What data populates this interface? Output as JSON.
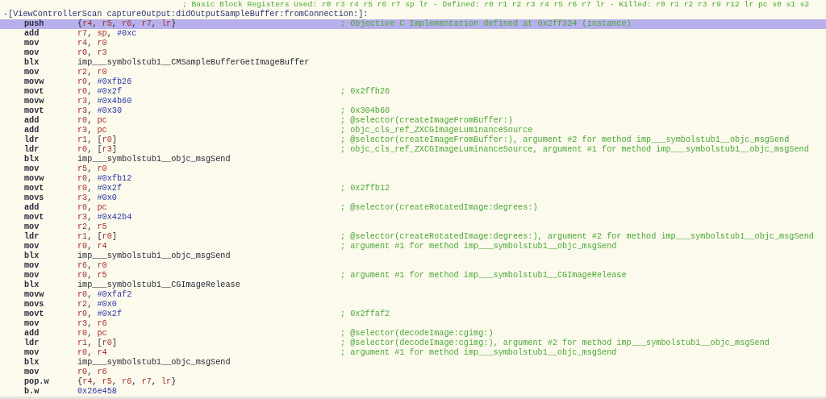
{
  "block_comment": "; Basic Block Registers Used: r0 r3 r4 r5 r6 r7 sp lr - Defined: r0 r1 r2 r3 r4 r5 r6 r7 lr - Killed: r0 r1 r2 r3 r9 r12 lr pc s0 s1 s2",
  "method_header": "-[ViewControllerScan captureOutput:didOutputSampleBuffer:fromConnection:]:",
  "lines": [
    {
      "mnemonic": "push",
      "operands": [
        {
          "text": "{",
          "kind": "punct"
        },
        {
          "text": "r4",
          "kind": "reg"
        },
        {
          "text": ", ",
          "kind": "punct"
        },
        {
          "text": "r5",
          "kind": "reg"
        },
        {
          "text": ", ",
          "kind": "punct"
        },
        {
          "text": "r6",
          "kind": "reg"
        },
        {
          "text": ", ",
          "kind": "punct"
        },
        {
          "text": "r7",
          "kind": "reg"
        },
        {
          "text": ", ",
          "kind": "punct"
        },
        {
          "text": "lr",
          "kind": "reg"
        },
        {
          "text": "}",
          "kind": "punct"
        }
      ],
      "comment": "; Objective C Implementation defined at 0x2ff324 (instance)",
      "selected": true
    },
    {
      "mnemonic": "add",
      "operands": [
        {
          "text": "r7",
          "kind": "reg"
        },
        {
          "text": ", ",
          "kind": "punct"
        },
        {
          "text": "sp",
          "kind": "reg"
        },
        {
          "text": ", ",
          "kind": "punct"
        },
        {
          "text": "#0xc",
          "kind": "imm"
        }
      ],
      "selected": false
    },
    {
      "mnemonic": "mov",
      "operands": [
        {
          "text": "r4",
          "kind": "reg"
        },
        {
          "text": ", ",
          "kind": "punct"
        },
        {
          "text": "r0",
          "kind": "reg"
        }
      ],
      "selected": false
    },
    {
      "mnemonic": "mov",
      "operands": [
        {
          "text": "r0",
          "kind": "reg"
        },
        {
          "text": ", ",
          "kind": "punct"
        },
        {
          "text": "r3",
          "kind": "reg"
        }
      ],
      "selected": false
    },
    {
      "mnemonic": "blx",
      "operands": [
        {
          "text": "imp___symbolstub1__CMSampleBufferGetImageBuffer",
          "kind": "sym"
        }
      ],
      "selected": false
    },
    {
      "mnemonic": "mov",
      "operands": [
        {
          "text": "r2",
          "kind": "reg"
        },
        {
          "text": ", ",
          "kind": "punct"
        },
        {
          "text": "r0",
          "kind": "reg"
        }
      ],
      "selected": false
    },
    {
      "mnemonic": "movw",
      "operands": [
        {
          "text": "r0",
          "kind": "reg"
        },
        {
          "text": ", ",
          "kind": "punct"
        },
        {
          "text": "#0xfb26",
          "kind": "imm"
        }
      ],
      "selected": false
    },
    {
      "mnemonic": "movt",
      "operands": [
        {
          "text": "r0",
          "kind": "reg"
        },
        {
          "text": ", ",
          "kind": "punct"
        },
        {
          "text": "#0x2f",
          "kind": "imm"
        }
      ],
      "comment": "; 0x2ffb26",
      "selected": false
    },
    {
      "mnemonic": "movw",
      "operands": [
        {
          "text": "r3",
          "kind": "reg"
        },
        {
          "text": ", ",
          "kind": "punct"
        },
        {
          "text": "#0x4b60",
          "kind": "imm"
        }
      ],
      "selected": false
    },
    {
      "mnemonic": "movt",
      "operands": [
        {
          "text": "r3",
          "kind": "reg"
        },
        {
          "text": ", ",
          "kind": "punct"
        },
        {
          "text": "#0x30",
          "kind": "imm"
        }
      ],
      "comment": "; 0x304b60",
      "selected": false
    },
    {
      "mnemonic": "add",
      "operands": [
        {
          "text": "r0",
          "kind": "reg"
        },
        {
          "text": ", ",
          "kind": "punct"
        },
        {
          "text": "pc",
          "kind": "reg"
        }
      ],
      "comment": "; @selector(createImageFromBuffer:)",
      "selected": false
    },
    {
      "mnemonic": "add",
      "operands": [
        {
          "text": "r3",
          "kind": "reg"
        },
        {
          "text": ", ",
          "kind": "punct"
        },
        {
          "text": "pc",
          "kind": "reg"
        }
      ],
      "comment": "; objc_cls_ref_ZXCGImageLuminanceSource",
      "selected": false
    },
    {
      "mnemonic": "ldr",
      "operands": [
        {
          "text": "r1",
          "kind": "reg"
        },
        {
          "text": ", [",
          "kind": "punct"
        },
        {
          "text": "r0",
          "kind": "reg"
        },
        {
          "text": "]",
          "kind": "punct"
        }
      ],
      "comment": "; @selector(createImageFromBuffer:), argument #2 for method imp___symbolstub1__objc_msgSend",
      "selected": false
    },
    {
      "mnemonic": "ldr",
      "operands": [
        {
          "text": "r0",
          "kind": "reg"
        },
        {
          "text": ", [",
          "kind": "punct"
        },
        {
          "text": "r3",
          "kind": "reg"
        },
        {
          "text": "]",
          "kind": "punct"
        }
      ],
      "comment": "; objc_cls_ref_ZXCGImageLuminanceSource, argument #1 for method imp___symbolstub1__objc_msgSend",
      "selected": false
    },
    {
      "mnemonic": "blx",
      "operands": [
        {
          "text": "imp___symbolstub1__objc_msgSend",
          "kind": "sym"
        }
      ],
      "selected": false
    },
    {
      "mnemonic": "mov",
      "operands": [
        {
          "text": "r5",
          "kind": "reg"
        },
        {
          "text": ", ",
          "kind": "punct"
        },
        {
          "text": "r0",
          "kind": "reg"
        }
      ],
      "selected": false
    },
    {
      "mnemonic": "movw",
      "operands": [
        {
          "text": "r0",
          "kind": "reg"
        },
        {
          "text": ", ",
          "kind": "punct"
        },
        {
          "text": "#0xfb12",
          "kind": "imm"
        }
      ],
      "selected": false
    },
    {
      "mnemonic": "movt",
      "operands": [
        {
          "text": "r0",
          "kind": "reg"
        },
        {
          "text": ", ",
          "kind": "punct"
        },
        {
          "text": "#0x2f",
          "kind": "imm"
        }
      ],
      "comment": "; 0x2ffb12",
      "selected": false
    },
    {
      "mnemonic": "movs",
      "operands": [
        {
          "text": "r3",
          "kind": "reg"
        },
        {
          "text": ", ",
          "kind": "punct"
        },
        {
          "text": "#0x0",
          "kind": "imm"
        }
      ],
      "selected": false
    },
    {
      "mnemonic": "add",
      "operands": [
        {
          "text": "r0",
          "kind": "reg"
        },
        {
          "text": ", ",
          "kind": "punct"
        },
        {
          "text": "pc",
          "kind": "reg"
        }
      ],
      "comment": "; @selector(createRotatedImage:degrees:)",
      "selected": false
    },
    {
      "mnemonic": "movt",
      "operands": [
        {
          "text": "r3",
          "kind": "reg"
        },
        {
          "text": ", ",
          "kind": "punct"
        },
        {
          "text": "#0x42b4",
          "kind": "imm"
        }
      ],
      "selected": false
    },
    {
      "mnemonic": "mov",
      "operands": [
        {
          "text": "r2",
          "kind": "reg"
        },
        {
          "text": ", ",
          "kind": "punct"
        },
        {
          "text": "r5",
          "kind": "reg"
        }
      ],
      "selected": false
    },
    {
      "mnemonic": "ldr",
      "operands": [
        {
          "text": "r1",
          "kind": "reg"
        },
        {
          "text": ", [",
          "kind": "punct"
        },
        {
          "text": "r0",
          "kind": "reg"
        },
        {
          "text": "]",
          "kind": "punct"
        }
      ],
      "comment": "; @selector(createRotatedImage:degrees:), argument #2 for method imp___symbolstub1__objc_msgSend",
      "selected": false
    },
    {
      "mnemonic": "mov",
      "operands": [
        {
          "text": "r0",
          "kind": "reg"
        },
        {
          "text": ", ",
          "kind": "punct"
        },
        {
          "text": "r4",
          "kind": "reg"
        }
      ],
      "comment": "; argument #1 for method imp___symbolstub1__objc_msgSend",
      "selected": false
    },
    {
      "mnemonic": "blx",
      "operands": [
        {
          "text": "imp___symbolstub1__objc_msgSend",
          "kind": "sym"
        }
      ],
      "selected": false
    },
    {
      "mnemonic": "mov",
      "operands": [
        {
          "text": "r6",
          "kind": "reg"
        },
        {
          "text": ", ",
          "kind": "punct"
        },
        {
          "text": "r0",
          "kind": "reg"
        }
      ],
      "selected": false
    },
    {
      "mnemonic": "mov",
      "operands": [
        {
          "text": "r0",
          "kind": "reg"
        },
        {
          "text": ", ",
          "kind": "punct"
        },
        {
          "text": "r5",
          "kind": "reg"
        }
      ],
      "comment": "; argument #1 for method imp___symbolstub1__CGImageRelease",
      "selected": false
    },
    {
      "mnemonic": "blx",
      "operands": [
        {
          "text": "imp___symbolstub1__CGImageRelease",
          "kind": "sym"
        }
      ],
      "selected": false
    },
    {
      "mnemonic": "movw",
      "operands": [
        {
          "text": "r0",
          "kind": "reg"
        },
        {
          "text": ", ",
          "kind": "punct"
        },
        {
          "text": "#0xfaf2",
          "kind": "imm"
        }
      ],
      "selected": false
    },
    {
      "mnemonic": "movs",
      "operands": [
        {
          "text": "r2",
          "kind": "reg"
        },
        {
          "text": ", ",
          "kind": "punct"
        },
        {
          "text": "#0x0",
          "kind": "imm"
        }
      ],
      "selected": false
    },
    {
      "mnemonic": "movt",
      "operands": [
        {
          "text": "r0",
          "kind": "reg"
        },
        {
          "text": ", ",
          "kind": "punct"
        },
        {
          "text": "#0x2f",
          "kind": "imm"
        }
      ],
      "comment": "; 0x2ffaf2",
      "selected": false
    },
    {
      "mnemonic": "mov",
      "operands": [
        {
          "text": "r3",
          "kind": "reg"
        },
        {
          "text": ", ",
          "kind": "punct"
        },
        {
          "text": "r6",
          "kind": "reg"
        }
      ],
      "selected": false
    },
    {
      "mnemonic": "add",
      "operands": [
        {
          "text": "r0",
          "kind": "reg"
        },
        {
          "text": ", ",
          "kind": "punct"
        },
        {
          "text": "pc",
          "kind": "reg"
        }
      ],
      "comment": "; @selector(decodeImage:cgimg:)",
      "selected": false
    },
    {
      "mnemonic": "ldr",
      "operands": [
        {
          "text": "r1",
          "kind": "reg"
        },
        {
          "text": ", [",
          "kind": "punct"
        },
        {
          "text": "r0",
          "kind": "reg"
        },
        {
          "text": "]",
          "kind": "punct"
        }
      ],
      "comment": "; @selector(decodeImage:cgimg:), argument #2 for method imp___symbolstub1__objc_msgSend",
      "selected": false
    },
    {
      "mnemonic": "mov",
      "operands": [
        {
          "text": "r0",
          "kind": "reg"
        },
        {
          "text": ", ",
          "kind": "punct"
        },
        {
          "text": "r4",
          "kind": "reg"
        }
      ],
      "comment": "; argument #1 for method imp___symbolstub1__objc_msgSend",
      "selected": false
    },
    {
      "mnemonic": "blx",
      "operands": [
        {
          "text": "imp___symbolstub1__objc_msgSend",
          "kind": "sym"
        }
      ],
      "selected": false
    },
    {
      "mnemonic": "mov",
      "operands": [
        {
          "text": "r0",
          "kind": "reg"
        },
        {
          "text": ", ",
          "kind": "punct"
        },
        {
          "text": "r6",
          "kind": "reg"
        }
      ],
      "selected": false
    },
    {
      "mnemonic": "pop.w",
      "operands": [
        {
          "text": "{",
          "kind": "punct"
        },
        {
          "text": "r4",
          "kind": "reg"
        },
        {
          "text": ", ",
          "kind": "punct"
        },
        {
          "text": "r5",
          "kind": "reg"
        },
        {
          "text": ", ",
          "kind": "punct"
        },
        {
          "text": "r6",
          "kind": "reg"
        },
        {
          "text": ", ",
          "kind": "punct"
        },
        {
          "text": "r7",
          "kind": "reg"
        },
        {
          "text": ", ",
          "kind": "punct"
        },
        {
          "text": "lr",
          "kind": "reg"
        },
        {
          "text": "}",
          "kind": "punct"
        }
      ],
      "selected": false
    },
    {
      "mnemonic": "b.w",
      "operands": [
        {
          "text": "0x26e458",
          "kind": "imm"
        }
      ],
      "selected": false
    }
  ]
}
